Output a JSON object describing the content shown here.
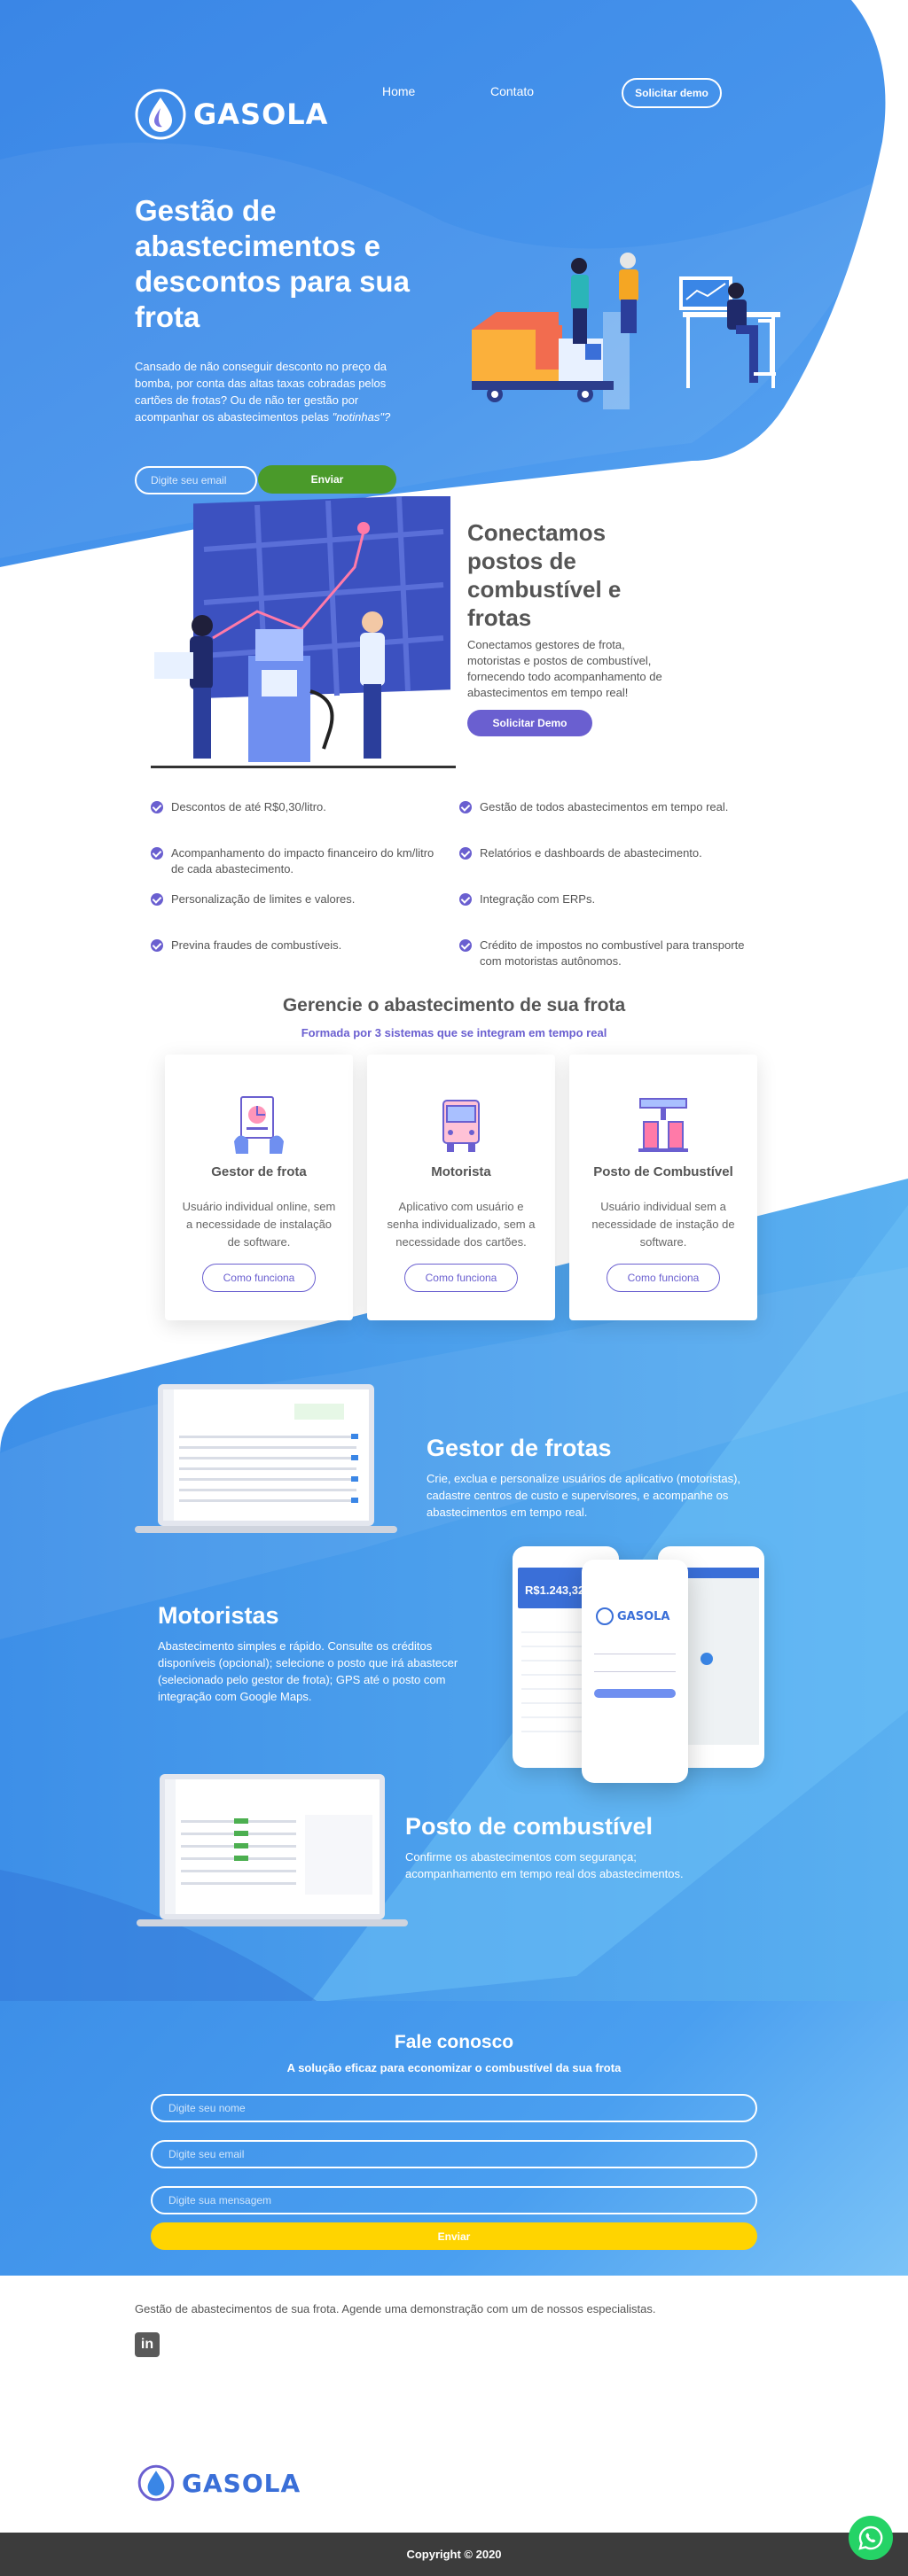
{
  "brand": {
    "name": "GASOLA",
    "colors": {
      "primary": "#3d8fe8",
      "accent": "#6a5fd0",
      "green": "#4a9a2a",
      "yellow": "#ffd400",
      "dark": "#3c3c3c"
    }
  },
  "nav": {
    "home": "Home",
    "contact": "Contato",
    "demo_button": "Solicitar demo"
  },
  "hero": {
    "title": "Gestão de abastecimentos e descontos para sua frota",
    "text_main": "Cansado de não conseguir desconto no preço da bomba, por conta das altas taxas cobradas pelos cartões de frotas? Ou de não ter gestão por acompanhar os abastecimentos pelas ",
    "text_em": "\"notinhas\"?",
    "email_placeholder": "Digite seu email",
    "send_button": "Enviar"
  },
  "connect": {
    "title": "Conectamos postos de combustível e frotas",
    "text": "Conectamos gestores de frota, motoristas e postos de combustível, fornecendo todo acompanhamento de abastecimentos em tempo real!",
    "button": "Solicitar Demo"
  },
  "features": {
    "left": [
      "Descontos de até R$0,30/litro.",
      "Acompanhamento do impacto financeiro do km/litro de cada abastecimento.",
      "Personalização de limites e valores.",
      "Previna fraudes de combustíveis."
    ],
    "right": [
      "Gestão de todos abastecimentos em tempo real.",
      "Relatórios e dashboards de abastecimento.",
      "Integração com ERPs.",
      "Crédito de impostos no combustível para transporte com motoristas autônomos."
    ]
  },
  "systems": {
    "title": "Gerencie o abastecimento de sua frota",
    "subtitle": "Formada por 3 sistemas que se integram em tempo real",
    "cards": [
      {
        "title": "Gestor de frota",
        "text": "Usuário individual online, sem a necessidade de instalação de software.",
        "button": "Como funciona",
        "icon": "fleet-manager-icon"
      },
      {
        "title": "Motorista",
        "text": "Aplicativo com usuário e senha individualizado, sem a necessidade dos cartões.",
        "button": "Como funciona",
        "icon": "truck-icon"
      },
      {
        "title": "Posto de Combustível",
        "text": "Usuário individual sem a necessidade de instação de software.",
        "button": "Como funciona",
        "icon": "gas-station-icon"
      }
    ]
  },
  "showcase": {
    "gestor": {
      "title": "Gestor de frotas",
      "text": "Crie, exclua e personalize usuários de aplicativo (motoristas), cadastre centros de custo e supervisores, e acompanhe os abastecimentos em tempo real."
    },
    "motoristas": {
      "title": "Motoristas",
      "text": "Abastecimento simples e rápido. Consulte os créditos disponíveis (opcional); selecione o posto que irá abastecer (selecionado pelo gestor de frota); GPS até o posto com integração com Google Maps."
    },
    "posto": {
      "title": "Posto de combustível",
      "text": "Confirme os abastecimentos com segurança; acompanhamento em tempo real dos abastecimentos."
    },
    "phone_balance": "R$1.243,32",
    "phone_logo": "GASOLA"
  },
  "contact": {
    "title": "Fale conosco",
    "subtitle": "A solução eficaz para economizar o combustível da sua frota",
    "name_placeholder": "Digite seu nome",
    "email_placeholder": "Digite seu email",
    "message_placeholder": "Digite sua mensagem",
    "send_button": "Enviar"
  },
  "footer": {
    "text": "Gestão de abastecimentos de sua frota. Agende uma demonstração com um de nossos especialistas.",
    "linkedin": "in",
    "logo": "GASOLA",
    "copyright": "Copyright © 2020"
  }
}
